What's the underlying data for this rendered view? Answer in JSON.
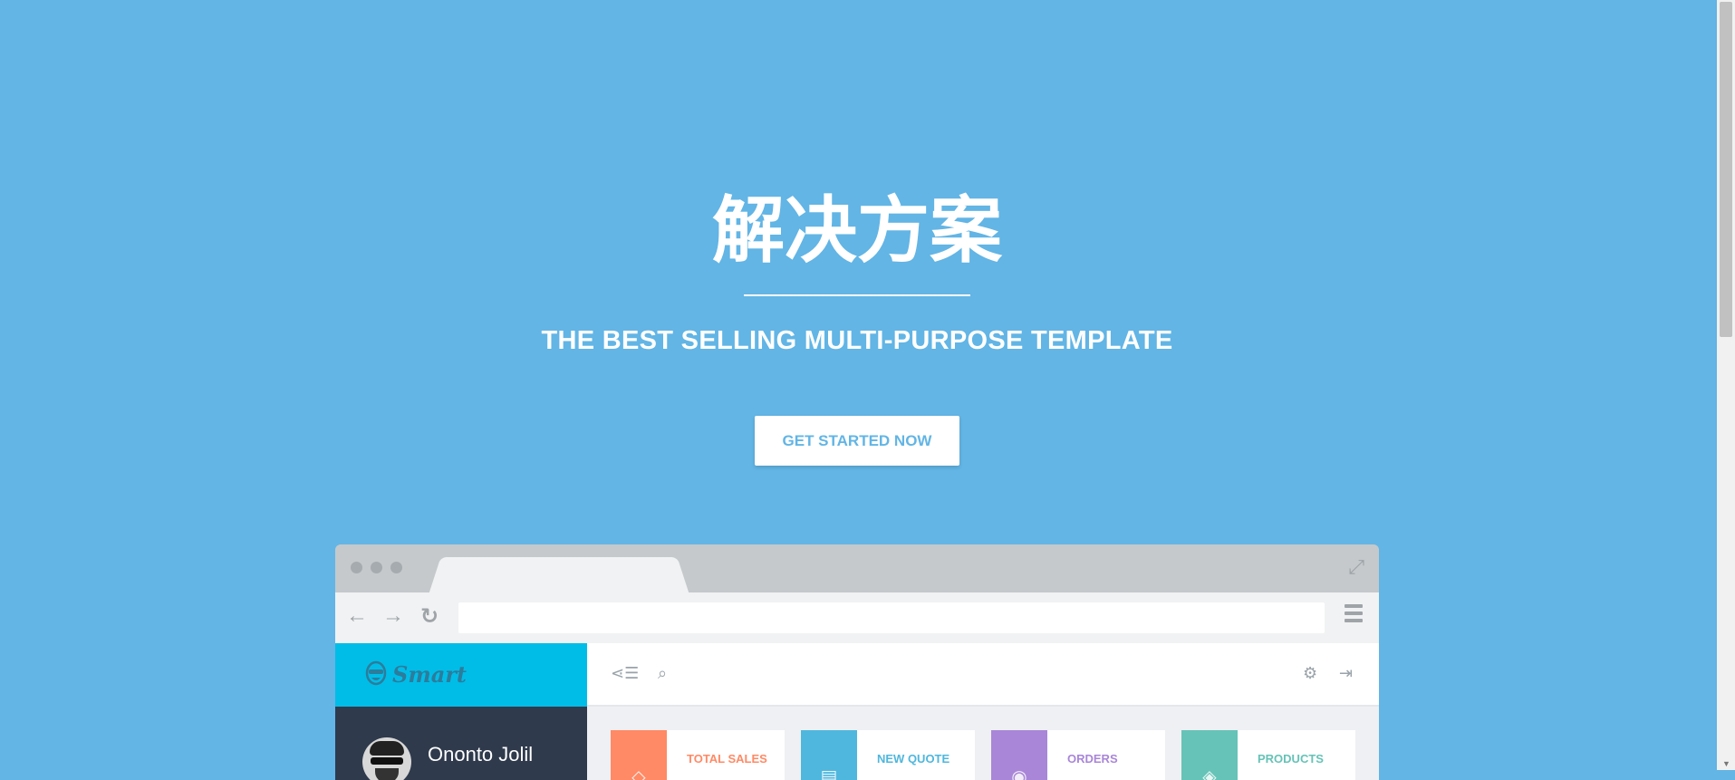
{
  "hero": {
    "title": "解决方案",
    "subtitle": "THE BEST SELLING MULTI-PURPOSE TEMPLATE",
    "cta_label": "GET STARTED NOW"
  },
  "mock_browser": {
    "address_value": "",
    "app": {
      "brand": "Smart",
      "user_name": "Ononto Jolil",
      "stats": [
        {
          "label": "TOTAL SALES",
          "color": "#ff8a65",
          "icon": "tag-icon"
        },
        {
          "label": "NEW QUOTE",
          "color": "#4fb7dd",
          "icon": "document-icon"
        },
        {
          "label": "ORDERS",
          "color": "#a986d8",
          "icon": "database-icon"
        },
        {
          "label": "PRODUCTS",
          "color": "#66c3b7",
          "icon": "cube-icon"
        }
      ]
    }
  },
  "colors": {
    "background": "#62b5e5",
    "brand_bar": "#00bde8",
    "sidebar": "#2f3a4c"
  }
}
